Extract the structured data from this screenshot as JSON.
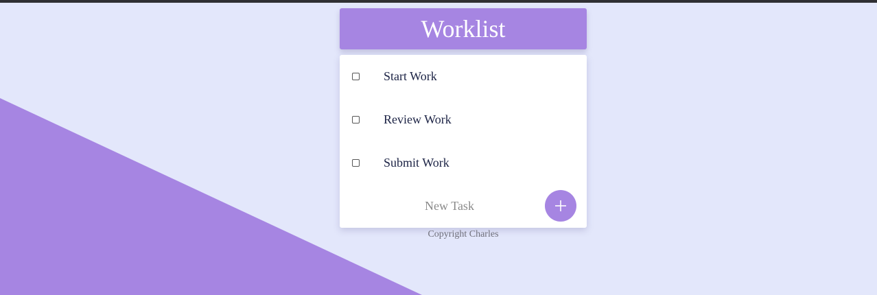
{
  "colors": {
    "background": "#E3E7FB",
    "accent": "#A685E2",
    "card": "#FFFFFF",
    "item_text": "#1B2244"
  },
  "header": {
    "title": "Worklist"
  },
  "tasks": [
    {
      "label": "Start Work",
      "checked": false
    },
    {
      "label": "Review Work",
      "checked": false
    },
    {
      "label": "Submit Work",
      "checked": false
    }
  ],
  "new_task": {
    "placeholder": "New Task",
    "add_icon": "plus-icon"
  },
  "footer": {
    "copyright": "Copyright Charles"
  }
}
